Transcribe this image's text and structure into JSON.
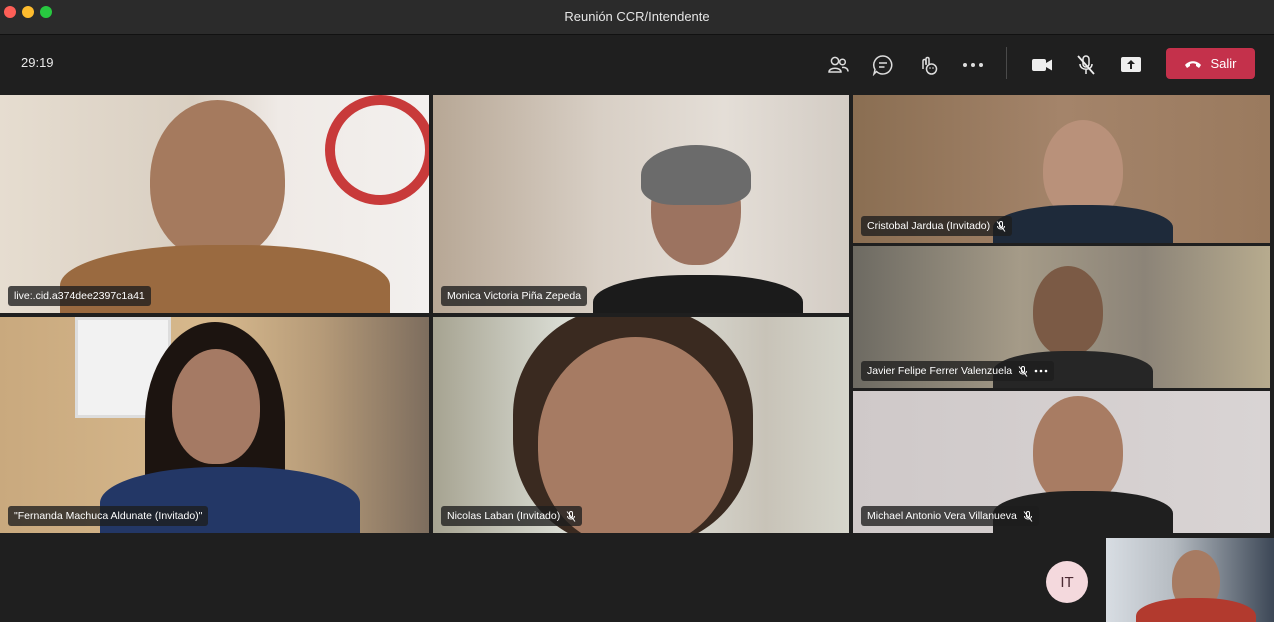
{
  "window": {
    "title": "Reunión CCR/Intendente"
  },
  "toolbar": {
    "timer": "29:19",
    "leave_label": "Salir",
    "icons": [
      "participants-icon",
      "chat-icon",
      "reactions-icon",
      "more-icon",
      "camera-icon",
      "mic-muted-icon",
      "share-icon",
      "hangup-icon"
    ]
  },
  "participants": {
    "p1": {
      "name": "live:.cid.a374dee2397c1a41"
    },
    "p2": {
      "name": "Monica Victoria Piña Zepeda"
    },
    "p3": {
      "name": "Cristobal Jardua (Invitado)"
    },
    "p4": {
      "name": "Javier Felipe Ferrer Valenzuela"
    },
    "p5": {
      "name": "\"Fernanda Machuca Aldunate (Invitado)\""
    },
    "p6": {
      "name": "Nicolas Laban (Invitado)"
    },
    "p7": {
      "name": "Michael Antonio Vera Villanueva"
    },
    "self": {
      "initials": "IT"
    }
  },
  "colors": {
    "leave": "#c4314b",
    "background": "#1f1f1f"
  }
}
